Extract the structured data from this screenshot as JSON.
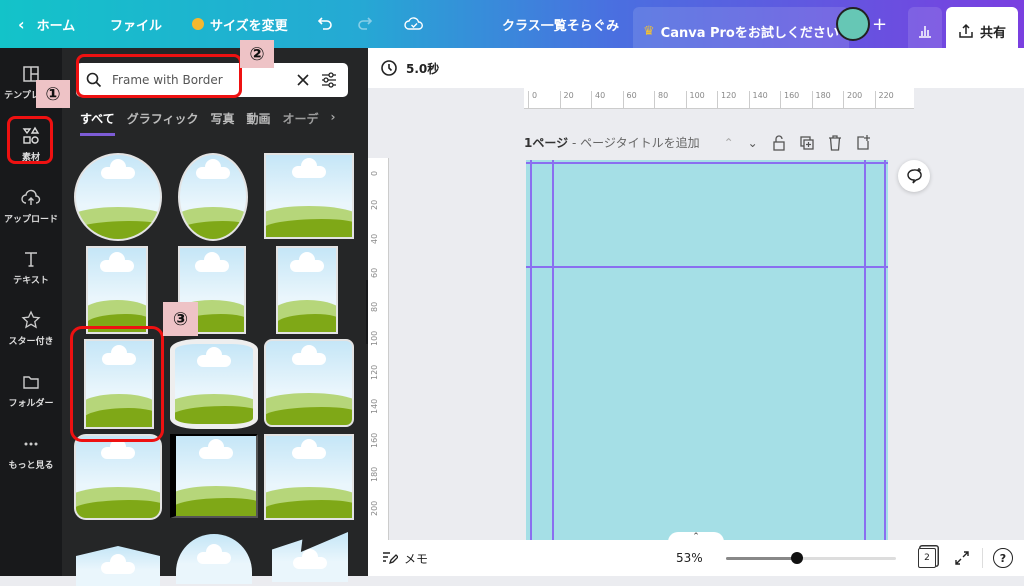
{
  "topbar": {
    "home_label": "ホーム",
    "file_label": "ファイル",
    "resize_label": "サイズを変更",
    "doc_title": "クラス一覧そらぐみ",
    "pro_label": "Canva Proをお試しください",
    "add_label": "+",
    "share_label": "共有"
  },
  "leftnav": {
    "items": [
      {
        "label": "テンプレート",
        "icon": "template-icon"
      },
      {
        "label": "素材",
        "icon": "elements-icon"
      },
      {
        "label": "アップロード",
        "icon": "upload-icon"
      },
      {
        "label": "テキスト",
        "icon": "text-icon"
      },
      {
        "label": "スター付き",
        "icon": "star-icon"
      },
      {
        "label": "フォルダー",
        "icon": "folder-icon"
      },
      {
        "label": "もっと見る",
        "icon": "more-icon"
      }
    ]
  },
  "panel": {
    "search_value": "Frame with Border",
    "tabs": [
      "すべて",
      "グラフィック",
      "写真",
      "動画",
      "オーデ"
    ],
    "active_tab": 0
  },
  "annotations": [
    "①",
    "②",
    "③"
  ],
  "canvas": {
    "duration": "5.0秒",
    "ruler_h": [
      "0",
      "20",
      "40",
      "60",
      "80",
      "100",
      "120",
      "140",
      "160",
      "180",
      "200",
      "220"
    ],
    "ruler_v": [
      "0",
      "20",
      "40",
      "60",
      "80",
      "100",
      "120",
      "140",
      "160",
      "180",
      "200"
    ],
    "page_label": "1ページ",
    "page_title_placeholder": " - ページタイトルを追加",
    "page_color": "#a5dfe6"
  },
  "bottombar": {
    "notes_label": "メモ",
    "zoom_value": "53%",
    "zoom_fraction": 0.42,
    "page_count": "2",
    "help": "?"
  }
}
